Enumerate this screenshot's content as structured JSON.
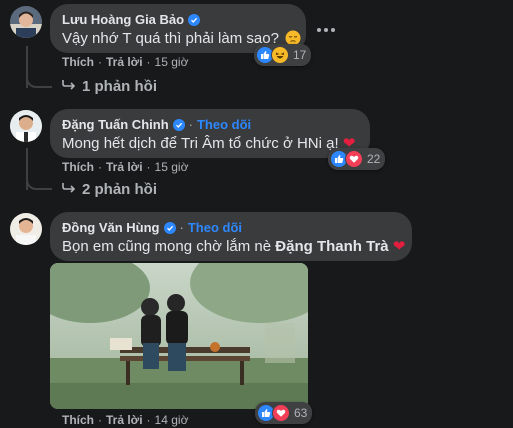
{
  "comments": [
    {
      "author": "Lưu Hoàng Gia Bảo",
      "text": "Vậy nhớ T quá thì phải làm sao?",
      "like_label": "Thích",
      "reply_label": "Trả lời",
      "time": "15 giờ",
      "reaction_count": "17",
      "reactions": [
        "like-icon",
        "haha-icon"
      ],
      "replies_label": "1 phản hồi"
    },
    {
      "author": "Đặng Tuấn Chinh",
      "follow_label": "Theo dõi",
      "text": "Mong hết dịch để Tri Âm tổ chức ở HNi ạ!",
      "like_label": "Thích",
      "reply_label": "Trả lời",
      "time": "15 giờ",
      "reaction_count": "22",
      "reactions": [
        "like-icon",
        "love-icon"
      ],
      "replies_label": "2 phản hồi"
    },
    {
      "author": "Đồng Văn Hùng",
      "follow_label": "Theo dõi",
      "text_prefix": "Bọn em cũng mong chờ lắm nè",
      "mention": "Đặng Thanh Trà",
      "like_label": "Thích",
      "reply_label": "Trả lời",
      "time": "14 giờ",
      "reaction_count": "63",
      "reactions": [
        "like-icon",
        "love-icon"
      ]
    }
  ],
  "colors": {
    "background": "#18191a",
    "bubble": "#3a3b3c",
    "text": "#e4e6eb",
    "secondary": "#b0b3b8",
    "accent": "#2d88ff",
    "love": "#f33e58",
    "haha": "#f7b928"
  }
}
